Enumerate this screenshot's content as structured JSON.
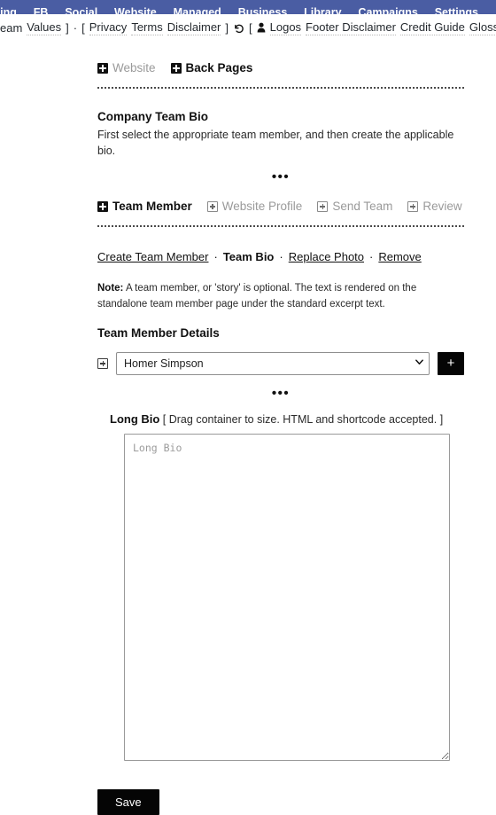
{
  "topnav": {
    "background": "#4a5da3",
    "items": [
      {
        "label": "ting"
      },
      {
        "label": "FB"
      },
      {
        "label": "Social"
      },
      {
        "label": "Website"
      },
      {
        "label": "Managed"
      },
      {
        "label": "Business"
      },
      {
        "label": "Library"
      },
      {
        "label": "Campaigns"
      },
      {
        "label": "Settings"
      }
    ]
  },
  "linkbar": {
    "team_label": "eam",
    "values_link": "Values",
    "close_bracket_1": "]",
    "mid_dot": "·",
    "open_bracket_2": "[",
    "privacy_link": "Privacy",
    "terms_link": "Terms",
    "disclaimer_link": "Disclaimer",
    "close_bracket_2": "]",
    "undo_icon": "↺",
    "open_bracket_3": "[",
    "person_icon": "\u0000",
    "logos_link": "Logos",
    "footer_disclaimer_link": "Footer Disclaimer",
    "credit_guide_link": "Credit Guide",
    "glossary_link": "Glossary",
    "close_bracket_3": "]"
  },
  "breadcrumb_tabs": {
    "items": [
      {
        "label": "Website",
        "active": false
      },
      {
        "label": "Back Pages",
        "active": true
      }
    ]
  },
  "section": {
    "title": "Company Team Bio",
    "description": "First select the appropriate team member, and then create the applicable bio.",
    "separator": "•••"
  },
  "member_tabs": {
    "items": [
      {
        "label": "Team Member",
        "active": true
      },
      {
        "label": "Website Profile",
        "active": false
      },
      {
        "label": "Send Team",
        "active": false
      },
      {
        "label": "Review",
        "active": false
      }
    ]
  },
  "action_links": {
    "create": "Create Team Member",
    "sep1": "·",
    "current": "Team Bio",
    "sep2": "·",
    "replace_photo": "Replace Photo",
    "sep3": "·",
    "remove": "Remove"
  },
  "note": {
    "label": "Note:",
    "text": " A team member, or 'story' is optional. The text is rendered on the standalone team member page under the standard excerpt text."
  },
  "details": {
    "heading": "Team Member Details",
    "selected_member": "Homer Simpson",
    "options": [
      "Homer Simpson"
    ],
    "add_button_label": "+"
  },
  "separator2": "•••",
  "long_bio": {
    "label": "Long Bio",
    "hint": " [ Drag container to size. HTML and shortcode accepted. ]",
    "placeholder": "Long Bio",
    "value": ""
  },
  "footer": {
    "save_label": "Save"
  }
}
